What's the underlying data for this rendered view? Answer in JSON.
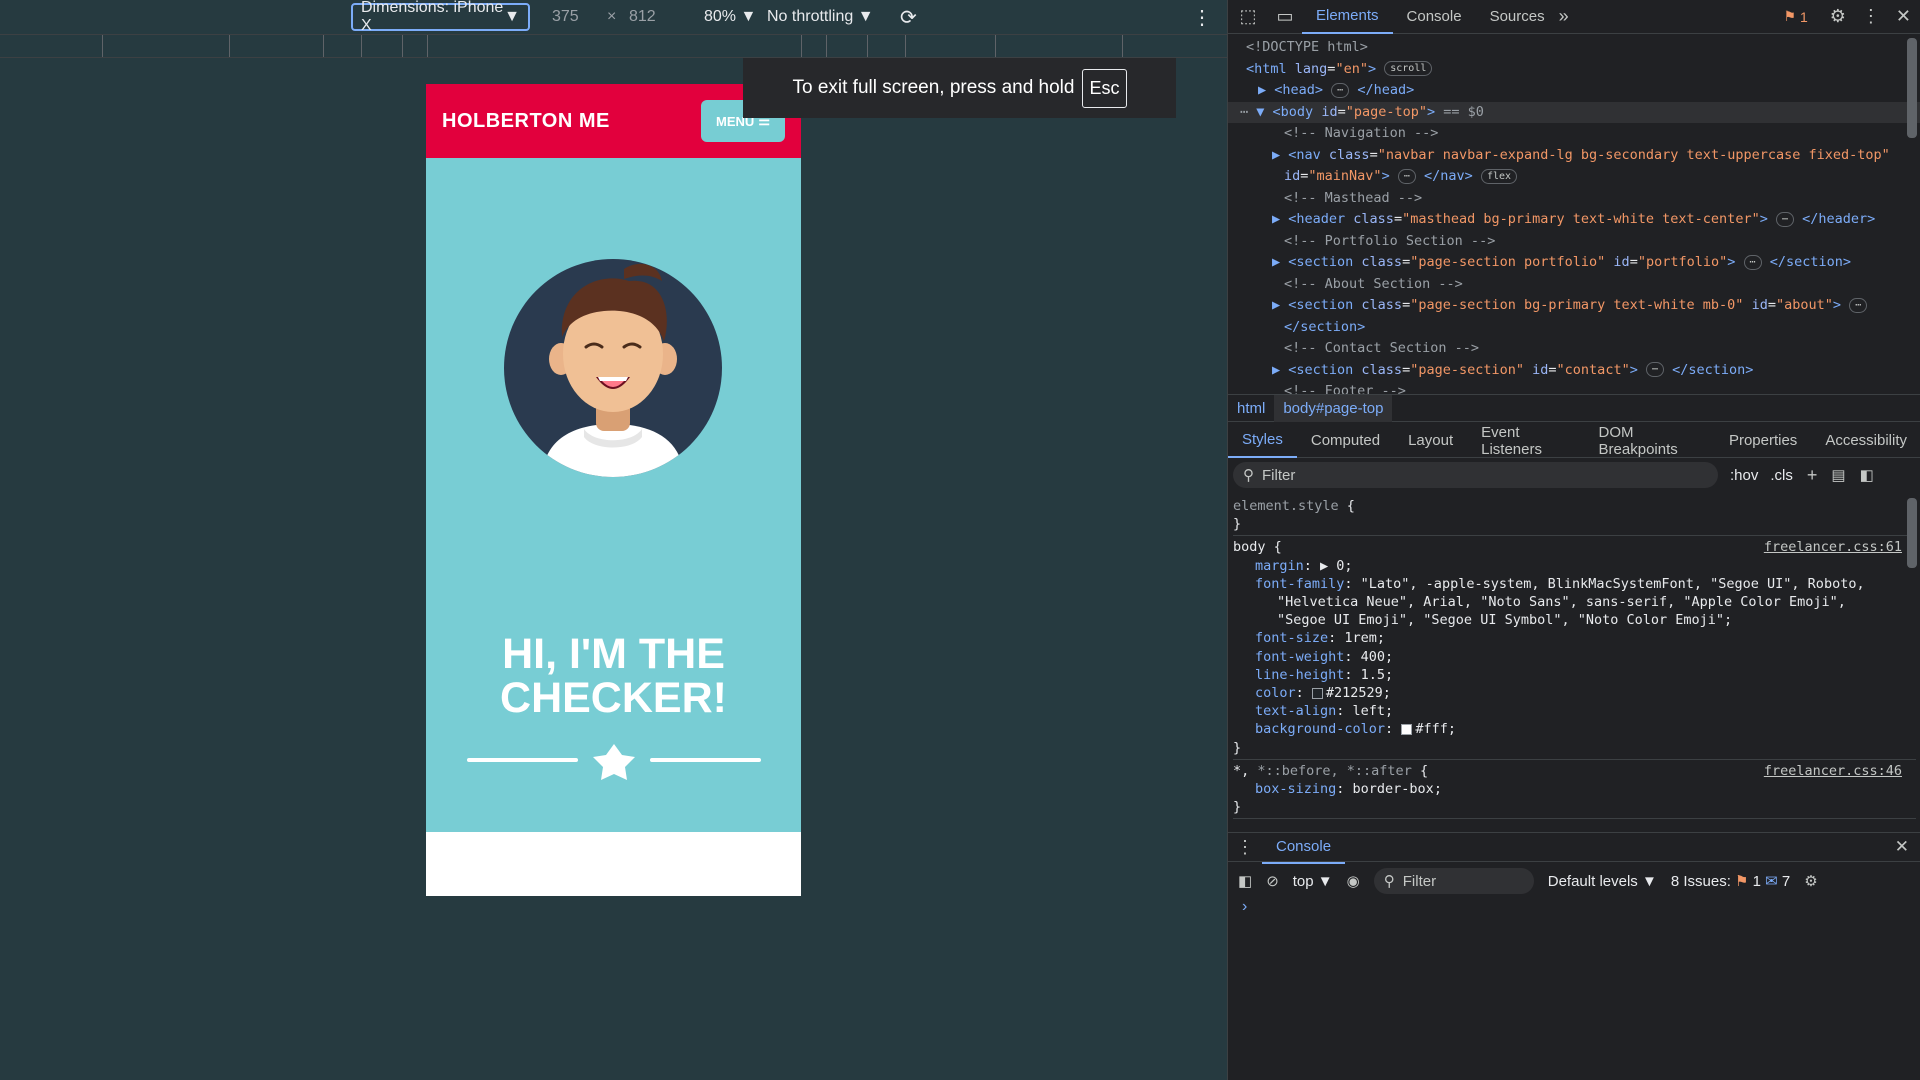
{
  "device_toolbar": {
    "dimensions_label": "Dimensions: iPhone X",
    "width": "375",
    "times": "×",
    "height": "812",
    "zoom": "80%",
    "throttling": "No throttling"
  },
  "fullscreen_toast": {
    "text": "To exit full screen, press and hold",
    "key": "Esc"
  },
  "page": {
    "brand": "HOLBERTON ME",
    "menu_label": "MENU",
    "heading_line1": "HI, I'M THE",
    "heading_line2": "CHECKER!",
    "colors": {
      "nav": "#e2003d",
      "masthead": "#78cdd4",
      "menu_button": "#77cdd3"
    }
  },
  "devtools": {
    "tabs": [
      "Elements",
      "Console",
      "Sources"
    ],
    "active_tab": "Elements",
    "issues_count": "1",
    "dom_lines": [
      {
        "html": "<span class='cmt'>&lt;!DOCTYPE html&gt;</span>"
      },
      {
        "html": "<span class='tagc'>&lt;html</span> <span class='att'>lang</span>=<span class='val'>\"en\"</span><span class='tagc'>&gt;</span> <span class='badge'>scroll</span>"
      }
    ],
    "breadcrumbs": [
      "html",
      "body#page-top"
    ],
    "styles_tabs": [
      "Styles",
      "Computed",
      "Layout",
      "Event Listeners",
      "DOM Breakpoints",
      "Properties",
      "Accessibility"
    ],
    "filter_placeholder": "Filter",
    "hov": ":hov",
    "cls": ".cls",
    "console": {
      "title": "Console",
      "context": "top",
      "filter": "Filter",
      "levels": "Default levels",
      "issues_label": "8 Issues:",
      "issues_warn": "1",
      "issues_info": "7"
    }
  }
}
